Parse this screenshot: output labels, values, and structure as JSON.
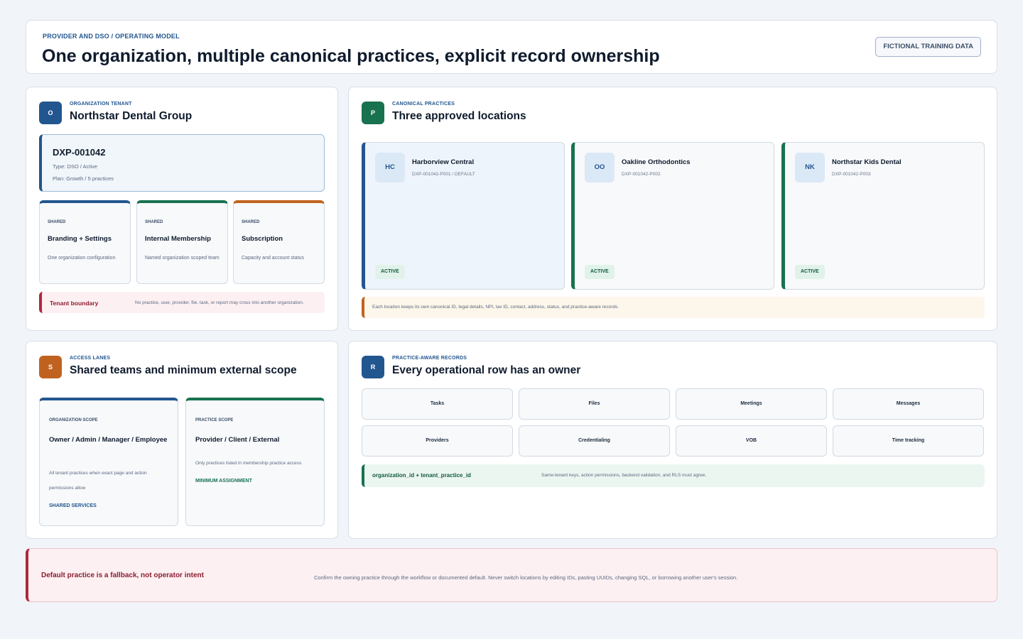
{
  "header": {
    "eyebrow": "PROVIDER AND DSO / OPERATING MODEL",
    "title": "One organization, multiple canonical practices, explicit record ownership",
    "badge": "FICTIONAL TRAINING DATA"
  },
  "organization": {
    "icon": "O",
    "eyebrow": "ORGANIZATION TENANT",
    "title": "Northstar Dental Group",
    "tenant": {
      "id": "DXP-001042",
      "type": "Type: DSO / Active",
      "plan": "Plan: Growth / 5 practices"
    },
    "shared": [
      {
        "kind": "SHARED",
        "title": "Branding + Settings",
        "desc": "One organization configuration",
        "color": "#22568f"
      },
      {
        "kind": "SHARED",
        "title": "Internal Membership",
        "desc": "Named organization scoped team",
        "color": "#18714f"
      },
      {
        "kind": "SHARED",
        "title": "Subscription",
        "desc": "Capacity and account status",
        "color": "#c0621f"
      }
    ],
    "boundary": {
      "label": "Tenant boundary",
      "text": "No practice, user, provider, file, task, or report may cross into another organization."
    }
  },
  "practices": {
    "icon": "P",
    "eyebrow": "CANONICAL PRACTICES",
    "title": "Three approved locations",
    "locations": [
      {
        "abbr": "HC",
        "name": "Harborview Central",
        "code": "DXP-001042-P001 / DEFAULT",
        "status": "ACTIVE"
      },
      {
        "abbr": "OO",
        "name": "Oakline Orthodontics",
        "code": "DXP-001042-P002",
        "status": "ACTIVE"
      },
      {
        "abbr": "NK",
        "name": "Northstar Kids Dental",
        "code": "DXP-001042-P003",
        "status": "ACTIVE"
      }
    ],
    "note": "Each location keeps its own canonical ID, legal details, NPI, tax ID, contact, address, status, and practice-aware records."
  },
  "access": {
    "icon": "S",
    "eyebrow": "ACCESS LANES",
    "title": "Shared teams and minimum external scope",
    "lanes": [
      {
        "kind": "ORGANIZATION SCOPE",
        "title": "Owner / Admin / Manager / Employee",
        "desc": "All tenant practices when exact page and action permissions allow",
        "tag": "SHARED SERVICES",
        "color": "#22568f"
      },
      {
        "kind": "PRACTICE SCOPE",
        "title": "Provider / Client / External",
        "desc": "Only practices listed in membership practice access",
        "tag": "MINIMUM ASSIGNMENT",
        "color": "#18714f"
      }
    ]
  },
  "records": {
    "icon": "R",
    "eyebrow": "PRACTICE-AWARE RECORDS",
    "title": "Every operational row has an owner",
    "items": [
      "Tasks",
      "Files",
      "Meetings",
      "Messages",
      "Providers",
      "Credentialing",
      "VOB",
      "Time tracking"
    ],
    "keys": "organization_id + tenant_practice_id",
    "keys_note": "Same-tenant keys, action permissions, backend validation, and RLS must agree."
  },
  "warning": {
    "title": "Default practice is a fallback, not operator intent",
    "text": "Confirm the owning practice through the workflow or documented default. Never switch locations by editing IDs, pasting UUIDs, changing SQL, or borrowing another user's session."
  },
  "colors": {
    "org_blue": "#22568f",
    "practice_green": "#18714f",
    "access_orange": "#c0621f",
    "records_blue": "#22568f",
    "warning_red": "#b0273e"
  }
}
